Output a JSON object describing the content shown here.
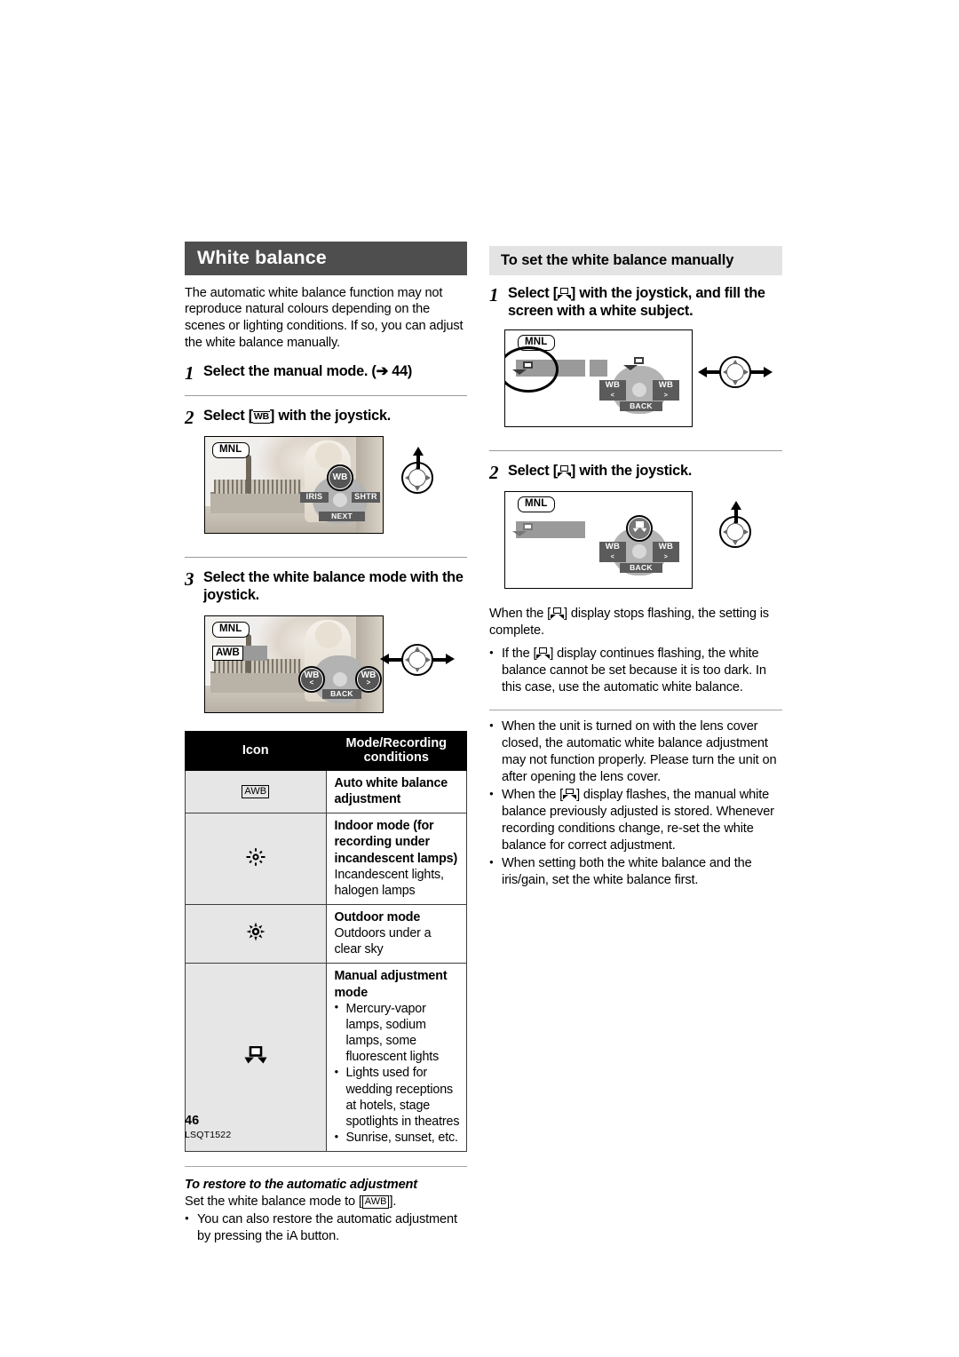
{
  "page": {
    "number": "46",
    "doc_id": "LSQT1522"
  },
  "left": {
    "title": "White balance",
    "intro": "The automatic white balance function may not reproduce natural colours depending on the scenes or lighting conditions. If so, you can adjust the white balance manually.",
    "steps": [
      {
        "num": "1",
        "text_before": "Select the manual mode. (",
        "arrow": "➔",
        "text_after": " 44)"
      },
      {
        "num": "2",
        "text_before": "Select [",
        "token": "WB",
        "text_after": "] with the joystick."
      },
      {
        "num": "3",
        "text": "Select the white balance mode with the joystick."
      }
    ],
    "fig1": {
      "mnl_label": "MNL",
      "chip_iris": "IRIS",
      "chip_shtr": "SHTR",
      "chip_next": "NEXT",
      "btn_wb": "WB",
      "joystick_direction": "up"
    },
    "fig2": {
      "mnl_label": "MNL",
      "awb_label": "AWB",
      "btn_wb_left": "WB",
      "btn_wb_left_sub": "<",
      "btn_wb_right": "WB",
      "btn_wb_right_sub": ">",
      "chip_back": "BACK",
      "joystick_direction": "left-right"
    },
    "table": {
      "headers": [
        "Icon",
        "Mode/Recording conditions"
      ],
      "rows": [
        {
          "icon": "awb-icon",
          "icon_label": "AWB",
          "title": "Auto white balance adjustment",
          "desc": "",
          "bullets": []
        },
        {
          "icon": "indoor-lamp-icon",
          "icon_label": "",
          "title": "Indoor mode (for recording under incandescent lamps)",
          "desc": "Incandescent lights, halogen lamps",
          "bullets": []
        },
        {
          "icon": "outdoor-sun-icon",
          "icon_label": "",
          "title": "Outdoor mode",
          "desc": "Outdoors under a clear sky",
          "bullets": []
        },
        {
          "icon": "manual-wb-icon",
          "icon_label": "",
          "title": "Manual adjustment mode",
          "desc": "",
          "bullets": [
            "Mercury-vapor lamps, sodium lamps, some fluorescent lights",
            "Lights used for wedding receptions at hotels, stage spotlights in theatres",
            "Sunrise, sunset, etc."
          ]
        }
      ]
    },
    "restore": {
      "heading": "To restore to the automatic adjustment",
      "line_before": "Set the white balance mode to [",
      "token": "AWB",
      "line_after": "].",
      "bullet": "You can also restore the automatic adjustment by pressing the iA button."
    }
  },
  "right": {
    "title": "To set the white balance manually",
    "steps": [
      {
        "num": "1",
        "text_before": "Select [",
        "text_after": "] with the joystick, and fill the screen with a white subject."
      },
      {
        "num": "2",
        "text_before": "Select [",
        "text_after": "] with the joystick."
      }
    ],
    "fig1": {
      "mnl_label": "MNL",
      "btn_wb_left": "WB",
      "btn_wb_left_sub": "<",
      "btn_wb_right": "WB",
      "btn_wb_right_sub": ">",
      "chip_back": "BACK",
      "joystick_direction": "left-right"
    },
    "fig2": {
      "mnl_label": "MNL",
      "btn_wb_left": "WB",
      "btn_wb_left_sub": "<",
      "btn_wb_right": "WB",
      "btn_wb_right_sub": ">",
      "chip_back": "BACK",
      "joystick_direction": "up"
    },
    "after_fig2_before": "When the [",
    "after_fig2_after": "] display stops flashing, the setting is complete.",
    "bullets_group1": [
      {
        "before": "If the [",
        "after": "] display continues flashing, the white balance cannot be set because it is too dark. In this case, use the automatic white balance."
      }
    ],
    "bullets_group2": [
      {
        "text": "When the unit is turned on with the lens cover closed, the automatic white balance adjustment may not function properly. Please turn the unit on after opening the lens cover."
      },
      {
        "before": "When the [",
        "after": "] display flashes, the manual white balance previously adjusted is stored. Whenever recording conditions change, re-set the white balance for correct adjustment."
      },
      {
        "text": "When setting both the white balance and the iris/gain, set the white balance first."
      }
    ]
  },
  "colors": {
    "title_bar_bg": "#4e4e4e",
    "subtitle_bar_bg": "#e3e3e3",
    "table_header_bg": "#000000",
    "icon_cell_bg": "#e6e6e6"
  }
}
